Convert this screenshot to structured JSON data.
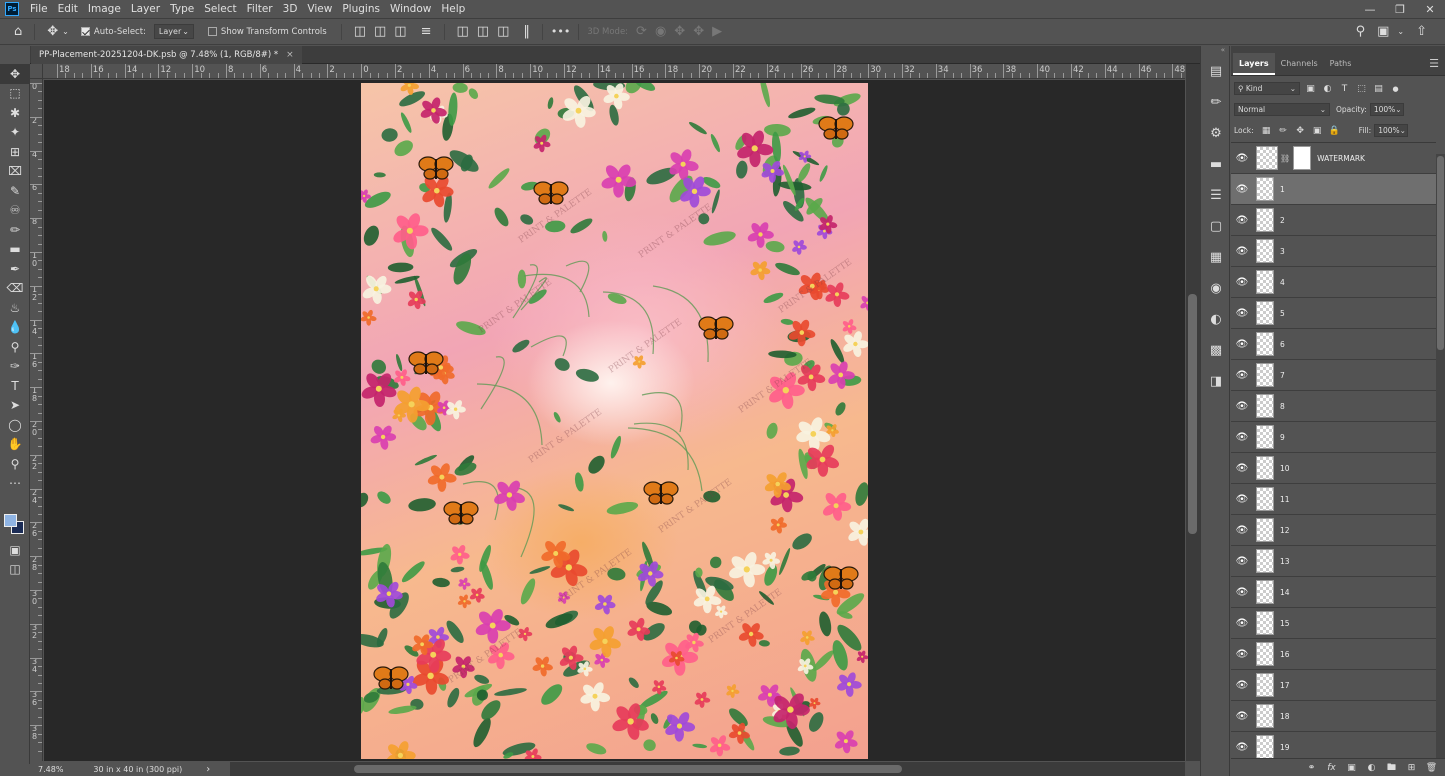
{
  "menu": {
    "logo": "Ps",
    "items": [
      "File",
      "Edit",
      "Image",
      "Layer",
      "Type",
      "Select",
      "Filter",
      "3D",
      "View",
      "Plugins",
      "Window",
      "Help"
    ]
  },
  "options": {
    "auto_select_label": "Auto-Select:",
    "auto_select_target": "Layer",
    "transform_label": "Show Transform Controls",
    "more": "•••",
    "mode_3d": "3D Mode:"
  },
  "document": {
    "tab_title": "PP-Placement-20251204-DK.psb @ 7.48% (1, RGB/8#) *",
    "close": "×",
    "watermark_text": "PRINT & PALETTE"
  },
  "rulers": {
    "h_labels": [
      "18",
      "16",
      "14",
      "12",
      "10",
      "8",
      "6",
      "4",
      "2",
      "0",
      "2",
      "4",
      "6",
      "8",
      "10",
      "12",
      "14",
      "16",
      "18",
      "20",
      "22",
      "24",
      "26",
      "28",
      "30",
      "32",
      "34",
      "36",
      "38",
      "40",
      "42",
      "44",
      "46",
      "48"
    ],
    "v_labels": [
      "0",
      "2",
      "4",
      "6",
      "8",
      "10",
      "12",
      "14",
      "16",
      "18",
      "20",
      "22",
      "24",
      "26",
      "28",
      "30",
      "32",
      "34",
      "36",
      "38"
    ]
  },
  "status": {
    "zoom": "7.48%",
    "doc_size": "30 in x 40 in (300 ppi)",
    "arrow": "›"
  },
  "panel": {
    "tabs": [
      "Layers",
      "Channels",
      "Paths"
    ],
    "active_tab": "Layers",
    "filter_kind": "Kind",
    "blend_mode": "Normal",
    "opacity_label": "Opacity:",
    "opacity_value": "100%",
    "lock_label": "Lock:",
    "fill_label": "Fill:",
    "fill_value": "100%",
    "layers": [
      {
        "name": "WATERMARK",
        "type": "watermark"
      },
      {
        "name": "1",
        "selected": true
      },
      {
        "name": "2"
      },
      {
        "name": "3"
      },
      {
        "name": "4"
      },
      {
        "name": "5"
      },
      {
        "name": "6"
      },
      {
        "name": "7"
      },
      {
        "name": "8"
      },
      {
        "name": "9"
      },
      {
        "name": "10"
      },
      {
        "name": "11"
      },
      {
        "name": "12"
      },
      {
        "name": "13"
      },
      {
        "name": "14"
      },
      {
        "name": "15"
      },
      {
        "name": "16"
      },
      {
        "name": "17"
      },
      {
        "name": "18"
      },
      {
        "name": "19"
      }
    ]
  },
  "colors": {
    "foreground": "#8fb4e4",
    "background": "#1b2c56",
    "ui_bg": "#535353",
    "canvas_bg": "#282828"
  }
}
